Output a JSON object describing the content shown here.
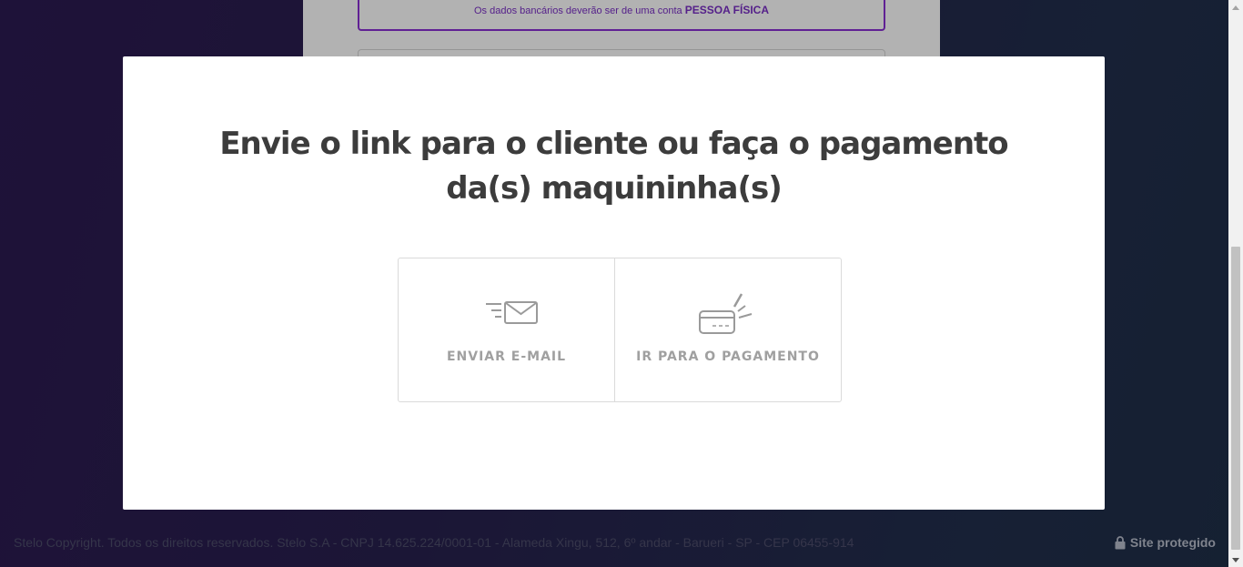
{
  "background": {
    "notice_text": "Os dados bancários deverão ser de uma conta",
    "notice_strong": "PESSOA FÍSICA",
    "footer_copyright": "Stelo Copyright. Todos os direitos reservados. Stelo S.A - CNPJ 14.625.224/0001-01 - Alameda Xingu, 512, 6º andar - Barueri - SP - CEP 06455-914",
    "footer_secure": "Site protegido"
  },
  "modal": {
    "title": "Envie o link para o cliente ou faça o pagamento da(s) maquininha(s)",
    "options": [
      {
        "label": "ENVIAR E-MAIL",
        "icon": "envelope-icon"
      },
      {
        "label": "IR PARA O PAGAMENTO",
        "icon": "credit-card-icon"
      }
    ]
  },
  "colors": {
    "accent_purple": "#8a2fd4",
    "title_text": "#3c3c3c",
    "option_text": "#a0a0a0"
  }
}
